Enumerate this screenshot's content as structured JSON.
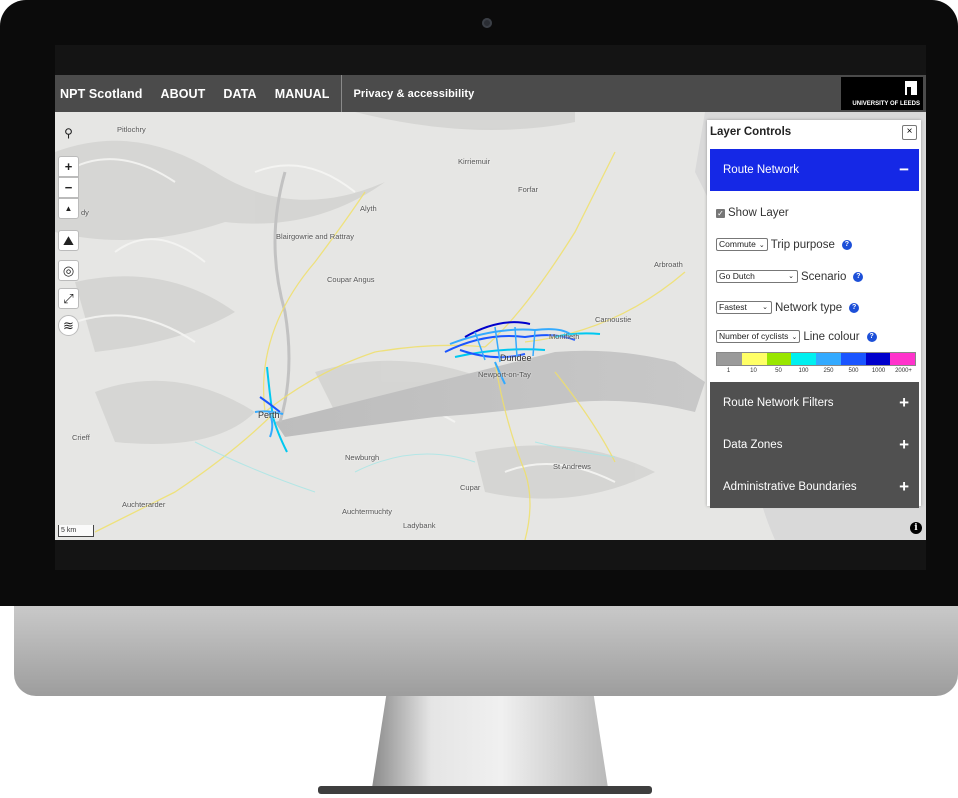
{
  "navbar": {
    "items": [
      "NPT Scotland",
      "ABOUT",
      "DATA",
      "MANUAL"
    ],
    "privacy": "Privacy & accessibility",
    "logo_text": "UNIVERSITY OF LEEDS"
  },
  "map": {
    "places": {
      "pitlochry": "Pitlochry",
      "kirriemuir": "Kirriemuir",
      "forfar": "Forfar",
      "dy": "dy",
      "alyth": "Alyth",
      "blairgowrie": "Blairgowrie and Rattray",
      "coupar_angus": "Coupar Angus",
      "arbroath": "Arbroath",
      "carnoustie": "Carnoustie",
      "monifieth": "Monifieth",
      "dundee": "Dundee",
      "newport": "Newport-on-Tay",
      "perth": "Perth",
      "crieff": "Crieff",
      "newburgh": "Newburgh",
      "st_andrews": "St Andrews",
      "cupar": "Cupar",
      "auchterarder": "Auchterarder",
      "auchtermuchty": "Auchtermuchty",
      "ladybank": "Ladybank"
    },
    "scale_label": "5 km",
    "info_icon": "i",
    "controls": {
      "search_icon": "⚲",
      "zoom_in": "+",
      "zoom_out": "−",
      "compass": "▲",
      "terrain_icon": "⛰",
      "locate_icon": "◎",
      "fullscreen_icon": "⤢",
      "layers_icon": "≋"
    }
  },
  "layer_controls": {
    "title": "Layer Controls",
    "close": "×",
    "route_network": {
      "label": "Route Network",
      "toggle": "−",
      "show_layer": "Show Layer",
      "trip_purpose": {
        "value": "Commute",
        "label": "Trip purpose"
      },
      "scenario": {
        "value": "Go Dutch",
        "label": "Scenario"
      },
      "network_type": {
        "value": "Fastest",
        "label": "Network type"
      },
      "line_colour": {
        "value": "Number of cyclists",
        "label": "Line colour"
      }
    },
    "legend": {
      "colors": [
        "#9a9a9a",
        "#ffff66",
        "#99e600",
        "#00f0f0",
        "#33aaff",
        "#1a55ff",
        "#0000cc",
        "#ff33cc"
      ],
      "labels": [
        "1",
        "10",
        "50",
        "100",
        "250",
        "500",
        "1000",
        "2000+"
      ]
    },
    "sections": [
      {
        "label": "Route Network Filters",
        "toggle": "+"
      },
      {
        "label": "Data Zones",
        "toggle": "+"
      },
      {
        "label": "Administrative Boundaries",
        "toggle": "+"
      }
    ],
    "help_icon": "?"
  }
}
